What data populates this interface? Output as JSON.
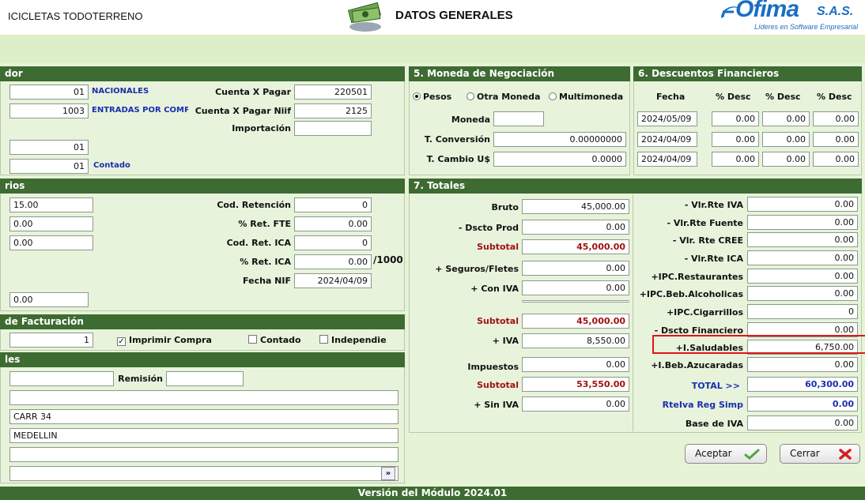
{
  "header": {
    "app_title": "ICICLETAS TODOTERRENO",
    "module_title": "DATOS GENERALES",
    "logo_text": "Ofima",
    "logo_suffix": "S.A.S.",
    "logo_tagline": "Líderes en Software Empresarial"
  },
  "left": {
    "sec1_title": "dor",
    "r1_code": "01",
    "r1_name": "NACIONALES",
    "cxp_label": "Cuenta X Pagar",
    "cxp_value": "220501",
    "r2_code": "1003",
    "r2_name": "ENTRADAS POR COMPI",
    "cxpn_label": "Cuenta X Pagar Niif",
    "cxpn_value": "2125",
    "import_label": "Importación",
    "import_value": "",
    "r4_value": "01",
    "r5_code": "01",
    "r5_name": "Contado",
    "sec2_title": "rios",
    "v1": "15.00",
    "v2": "0.00",
    "v3": "0.00",
    "codret_label": "Cod. Retención",
    "codret_value": "0",
    "retfte_label": "% Ret. FTE",
    "retfte_value": "0.00",
    "codica_label": "Cod. Ret. ICA",
    "codica_value": "0",
    "retica_label": "% Ret. ICA",
    "retica_value": "0.00",
    "per1000": "/1000",
    "fnif_label": "Fecha NIF",
    "fnif_value": "2024/04/09",
    "v4": "0.00",
    "sec3_title": "de Facturación",
    "fact_value": "1",
    "imprimir_label": "Imprimir Compra",
    "contado_label": "Contado",
    "indep_label": "Independie",
    "sec4_title": "les",
    "remision_label": "Remisión",
    "dir1": "CARR 34",
    "dir2": "MEDELLIN"
  },
  "moneda": {
    "title": "5. Moneda de Negociación",
    "opt1": "Pesos",
    "opt2": "Otra Moneda",
    "opt3": "Multimoneda",
    "moneda_label": "Moneda",
    "moneda_value": "",
    "tconv_label": "T. Conversión",
    "tconv_value": "0.00000000",
    "tcambio_label": "T. Cambio U$",
    "tcambio_value": "0.0000"
  },
  "descuentos": {
    "title": "6. Descuentos Financieros",
    "headers": [
      "Fecha",
      "% Desc",
      "% Desc",
      "% Desc"
    ],
    "rows": [
      [
        "2024/05/09",
        "0.00",
        "0.00",
        "0.00"
      ],
      [
        "2024/04/09",
        "0.00",
        "0.00",
        "0.00"
      ],
      [
        "2024/04/09",
        "0.00",
        "0.00",
        "0.00"
      ]
    ]
  },
  "totales": {
    "title": "7. Totales",
    "bruto_label": "Bruto",
    "bruto": "45,000.00",
    "dprod_label": "- Dscto Prod",
    "dprod": "0.00",
    "sub1_label": "Subtotal",
    "sub1": "45,000.00",
    "seg_label": "+ Seguros/Fletes",
    "seg": "0.00",
    "coniva_label": "+ Con IVA",
    "coniva": "0.00",
    "sub2_label": "Subtotal",
    "sub2": "45,000.00",
    "iva_label": "+ IVA",
    "iva": "8,550.00",
    "imp_label": "Impuestos",
    "imp": "0.00",
    "sub3_label": "Subtotal",
    "sub3": "53,550.00",
    "siniva_label": "+ Sin IVA",
    "siniva": "0.00",
    "right": [
      {
        "label": "- Vlr.Rte IVA",
        "value": "0.00"
      },
      {
        "label": "- Vlr.Rte Fuente",
        "value": "0.00"
      },
      {
        "label": "- Vlr. Rte CREE",
        "value": "0.00"
      },
      {
        "label": "- Vlr.Rte ICA",
        "value": "0.00"
      },
      {
        "label": "+IPC.Restaurantes",
        "value": "0.00"
      },
      {
        "label": "+IPC.Beb.Alcoholicas",
        "value": "0.00"
      },
      {
        "label": "+IPC.Cigarrillos",
        "value": "0"
      },
      {
        "label": "- Dscto Financiero",
        "value": "0.00"
      },
      {
        "label": "+I.Saludables",
        "value": "6,750.00"
      },
      {
        "label": "+I.Beb.Azucaradas",
        "value": "0.00"
      }
    ],
    "total_label": "TOTAL >>",
    "total": "60,300.00",
    "rteiva_label": "RteIva Reg Simp",
    "rteiva": "0.00",
    "base_label": "Base de IVA",
    "base": "0.00"
  },
  "buttons": {
    "aceptar": "Aceptar",
    "cerrar": "Cerrar"
  },
  "footer": "Versión del Módulo 2024.01"
}
